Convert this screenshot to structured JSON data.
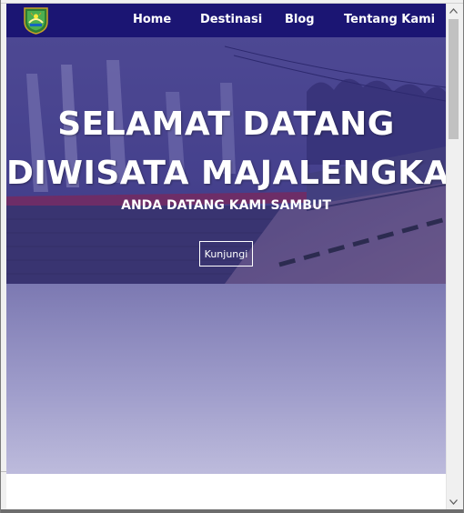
{
  "navbar": {
    "logo_icon": "majalengka-crest-icon",
    "items": [
      {
        "label": "Home"
      },
      {
        "label": "Destinasi"
      },
      {
        "label": "Blog"
      },
      {
        "label": "Tentang Kami"
      }
    ],
    "background_color": "#1b1573"
  },
  "hero": {
    "title_line1": "SELAMAT DATANG",
    "title_line2": "DIWISATA MAJALENGKA",
    "subtitle": "ANDA DATANG KAMI SAMBUT",
    "button_label": "Kunjungi",
    "overlay_color": "#3d3685"
  },
  "gradient_section": {
    "top_color": "#7c79b2",
    "bottom_color": "#bdbbdc"
  },
  "scrollbar": {
    "up_icon": "scroll-up-arrow-icon",
    "down_icon": "scroll-down-arrow-icon"
  }
}
